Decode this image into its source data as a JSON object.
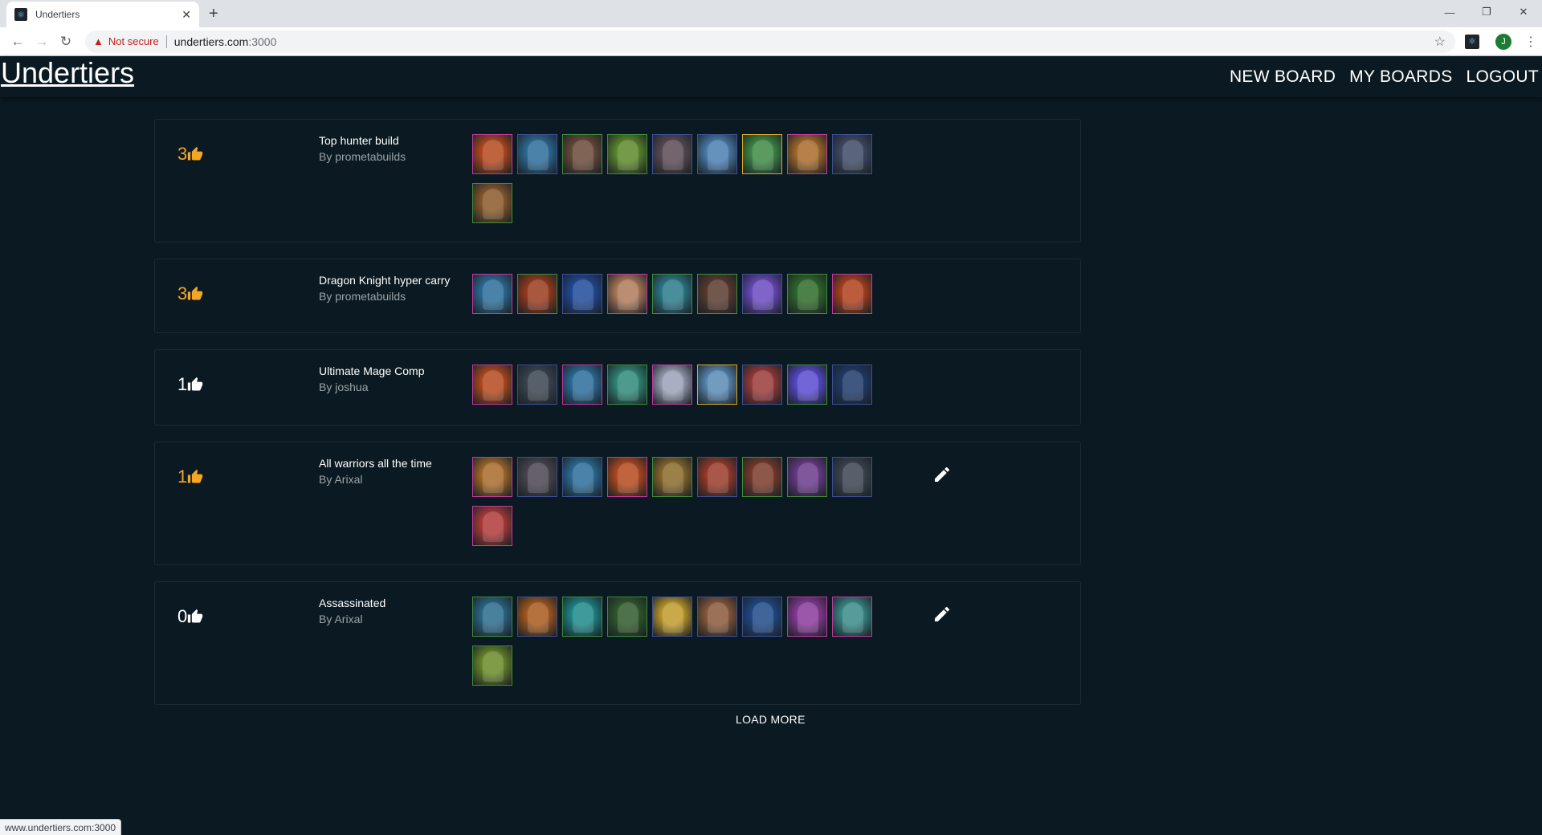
{
  "browser": {
    "tab_title": "Undertiers",
    "tab_close": "✕",
    "new_tab": "+",
    "not_secure": "Not secure",
    "url_host": "undertiers.com",
    "url_rest": ":3000",
    "profile_initial": "J",
    "status_url": "www.undertiers.com:3000"
  },
  "header": {
    "logo": "Undertiers",
    "nav": [
      "NEW BOARD",
      "MY BOARDS",
      "LOGOUT"
    ]
  },
  "boards": [
    {
      "votes": "3",
      "voted": true,
      "title": "Top hunter build",
      "author": "By prometabuilds",
      "editable": false,
      "heroes": [
        {
          "rarity": "pink",
          "color": "#b5491f"
        },
        {
          "rarity": "blue",
          "color": "#2c6d9a"
        },
        {
          "rarity": "green",
          "color": "#6a4a3a"
        },
        {
          "rarity": "green",
          "color": "#5d8a2b"
        },
        {
          "rarity": "blue",
          "color": "#5a4a55"
        },
        {
          "rarity": "blue",
          "color": "#4a7fb0"
        },
        {
          "rarity": "gold",
          "color": "#3f8a45"
        },
        {
          "rarity": "pink",
          "color": "#a86a2a"
        },
        {
          "rarity": "blue",
          "color": "#3e4a66"
        },
        {
          "rarity": "green",
          "color": "#8a5a2a"
        }
      ]
    },
    {
      "votes": "3",
      "voted": true,
      "title": "Dragon Knight hyper carry",
      "author": "By prometabuilds",
      "editable": false,
      "heroes": [
        {
          "rarity": "pink",
          "color": "#2c6d9a"
        },
        {
          "rarity": "green",
          "color": "#9a3a1e"
        },
        {
          "rarity": "blue",
          "color": "#1f4a9a"
        },
        {
          "rarity": "pink",
          "color": "#b07a5a"
        },
        {
          "rarity": "green",
          "color": "#2b7a8a"
        },
        {
          "rarity": "green",
          "color": "#5a3a2e"
        },
        {
          "rarity": "blue",
          "color": "#6a4ac0"
        },
        {
          "rarity": "green",
          "color": "#2f6a2a"
        },
        {
          "rarity": "pink",
          "color": "#b0401e"
        }
      ]
    },
    {
      "votes": "1",
      "voted": false,
      "title": "Ultimate Mage Comp",
      "author": "By joshua",
      "editable": false,
      "heroes": [
        {
          "rarity": "pink",
          "color": "#b5491f"
        },
        {
          "rarity": "blue",
          "color": "#3a4450"
        },
        {
          "rarity": "pink",
          "color": "#2c6d9a"
        },
        {
          "rarity": "green",
          "color": "#2f8a7a"
        },
        {
          "rarity": "pink",
          "color": "#9aa0b5"
        },
        {
          "rarity": "gold",
          "color": "#5a8ab5"
        },
        {
          "rarity": "blue",
          "color": "#9a3a3a"
        },
        {
          "rarity": "green",
          "color": "#5a4ad0"
        },
        {
          "rarity": "blue",
          "color": "#1f3a6a"
        }
      ]
    },
    {
      "votes": "1",
      "voted": true,
      "title": "All warriors all the time",
      "author": "By Arixal",
      "editable": true,
      "heroes": [
        {
          "rarity": "pink",
          "color": "#a86a2a"
        },
        {
          "rarity": "blue",
          "color": "#4a4550"
        },
        {
          "rarity": "blue",
          "color": "#2c6d9a"
        },
        {
          "rarity": "pink",
          "color": "#b5491f"
        },
        {
          "rarity": "green",
          "color": "#8a6a2a"
        },
        {
          "rarity": "blue",
          "color": "#9a3a2a"
        },
        {
          "rarity": "green",
          "color": "#7a3a2a"
        },
        {
          "rarity": "green",
          "color": "#6a3a8a"
        },
        {
          "rarity": "blue",
          "color": "#3a4450"
        },
        {
          "rarity": "pink",
          "color": "#b03a3a"
        }
      ]
    },
    {
      "votes": "0",
      "voted": false,
      "title": "Assassinated",
      "author": "By Arixal",
      "editable": true,
      "heroes": [
        {
          "rarity": "green",
          "color": "#2a6a8a"
        },
        {
          "rarity": "blue",
          "color": "#a85a1e"
        },
        {
          "rarity": "green",
          "color": "#1e8a8a"
        },
        {
          "rarity": "green",
          "color": "#2f5a2a"
        },
        {
          "rarity": "blue",
          "color": "#c09a2a"
        },
        {
          "rarity": "blue",
          "color": "#8a5a3a"
        },
        {
          "rarity": "blue",
          "color": "#1f4a8a"
        },
        {
          "rarity": "pink",
          "color": "#8a3a9a"
        },
        {
          "rarity": "pink",
          "color": "#3a8a8a"
        },
        {
          "rarity": "green",
          "color": "#6a8a2a"
        }
      ]
    }
  ],
  "load_more": "LOAD MORE",
  "colors": {
    "background": "#0b1a22",
    "voted": "#f5a623",
    "rarity_pink": "#c23aa0",
    "rarity_green": "#3e8d3a",
    "rarity_blue": "#3d4f96",
    "rarity_gold": "#d5a829"
  }
}
